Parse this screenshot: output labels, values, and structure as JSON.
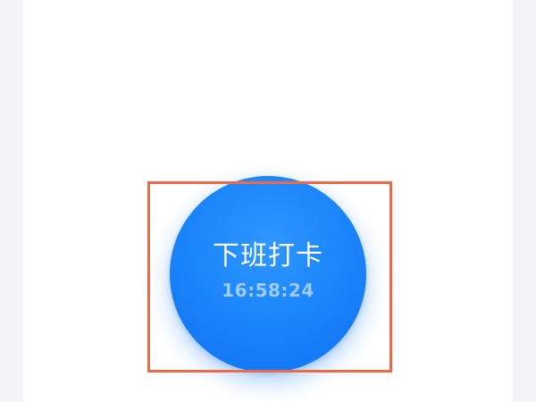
{
  "punch_button": {
    "label": "下班打卡",
    "time": "16:58:24"
  },
  "colors": {
    "button_blue": "#1c86fb",
    "time_text": "#9fcbff",
    "highlight_border": "#ec6a45",
    "background": "#f1f3f7",
    "panel": "#ffffff"
  }
}
